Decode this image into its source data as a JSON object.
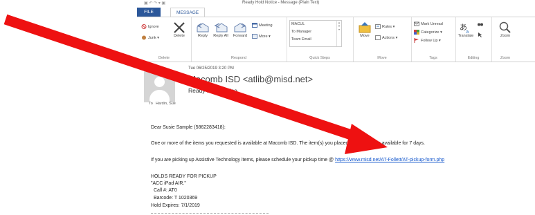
{
  "window": {
    "title": "Ready Hold Notice - Message (Plain Text)"
  },
  "tabs": [
    {
      "label": "FILE"
    },
    {
      "label": "MESSAGE"
    }
  ],
  "ribbon": {
    "delete_group": {
      "label": "Delete",
      "ignore": "Ignore",
      "junk": "Junk ▾",
      "delete": "Delete"
    },
    "respond_group": {
      "label": "Respond",
      "reply": "Reply",
      "reply_all": "Reply All",
      "forward": "Forward",
      "meeting": "Meeting",
      "more": "More ▾"
    },
    "quick_steps": {
      "label": "Quick Steps",
      "items": [
        "MACUL",
        "To Manager",
        "Team Email"
      ]
    },
    "move_group": {
      "label": "Move",
      "move": "Move",
      "rules": "Rules ▾",
      "actions": "Actions ▾"
    },
    "tags_group": {
      "label": "Tags",
      "unread": "Mark Unread",
      "categorize": "Categorize ▾",
      "follow_up": "Follow Up ▾"
    },
    "editing_group": {
      "label": "Editing",
      "translate": "Translate"
    },
    "zoom_group": {
      "label": "Zoom",
      "zoom": "Zoom"
    }
  },
  "message": {
    "date": "Tue 06/25/2019 3:20 PM",
    "sender": "Macomb ISD <atlib@misd.net>",
    "subject": "Ready Hold Notice",
    "to_label": "To",
    "to": "Hardin, Sue"
  },
  "body": {
    "greeting": "Dear Susie Sample (5862283418):",
    "line1": "One or more of the items you requested is available at Macomb ISD. The item(s) you placed on hold will be available for 7 days.",
    "line2_prefix": "If you are picking up Assistive Technology items, please schedule your pickup time @ ",
    "line2_link": "https://www.misd.net/AT-Follett/AT-pickup-form.php",
    "holds_header": "HOLDS READY FOR PICKUP",
    "item_title": "\"ACC iPad AIR.\"",
    "call_no": "Call #: AT0",
    "barcode": "Barcode: T 1020369",
    "hold_expires": "Hold Expires: 7/1/2019"
  },
  "annotation": {
    "color": "#ee1111"
  }
}
